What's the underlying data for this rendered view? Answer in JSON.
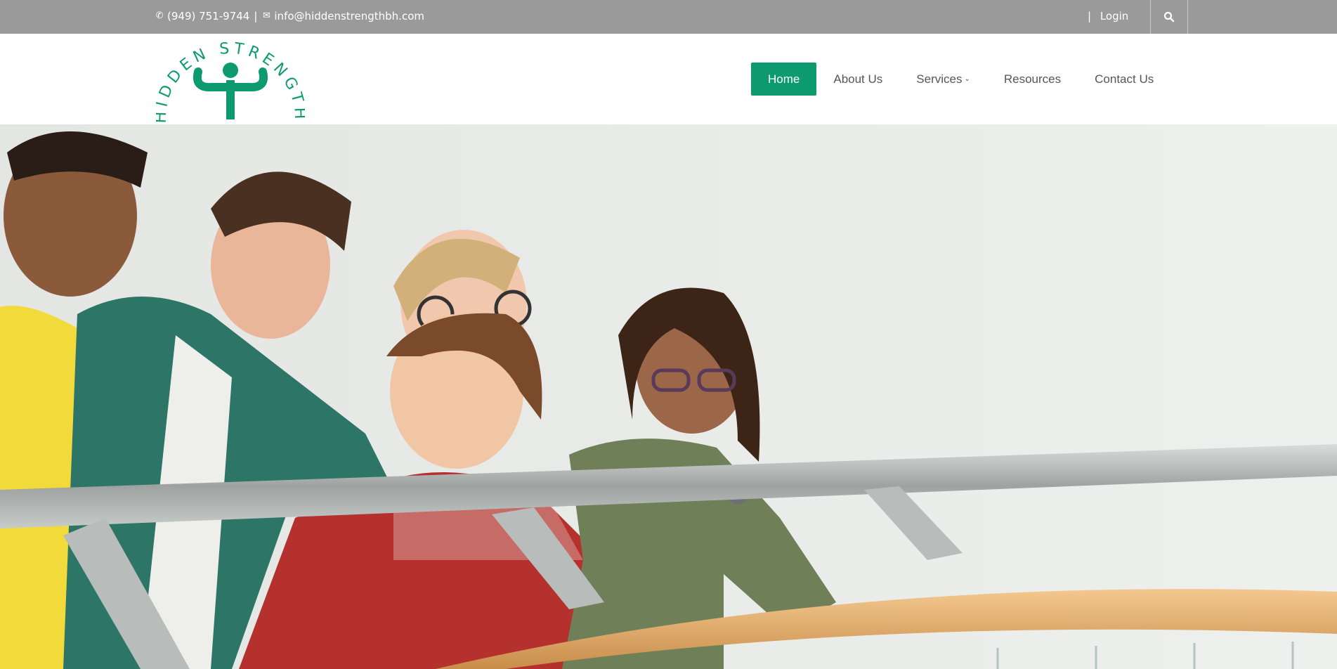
{
  "topbar": {
    "phone_icon": "phone-icon",
    "phone": "(949) 751-9744",
    "separator": "|",
    "email_icon": "envelope-icon",
    "email": "info@hiddenstrengthbh.com",
    "login_separator": "|",
    "login_label": "Login",
    "search_icon": "search-icon"
  },
  "header": {
    "logo_text": "HIDDEN STRENGTH",
    "nav": {
      "home": "Home",
      "about": "About Us",
      "services": "Services",
      "resources": "Resources",
      "contact": "Contact Us"
    }
  },
  "colors": {
    "brand_green": "#0d9a6e",
    "topbar_gray": "#9a9a9a"
  },
  "hero": {
    "image": "group of five smiling teenagers leaning on a metal railing"
  }
}
